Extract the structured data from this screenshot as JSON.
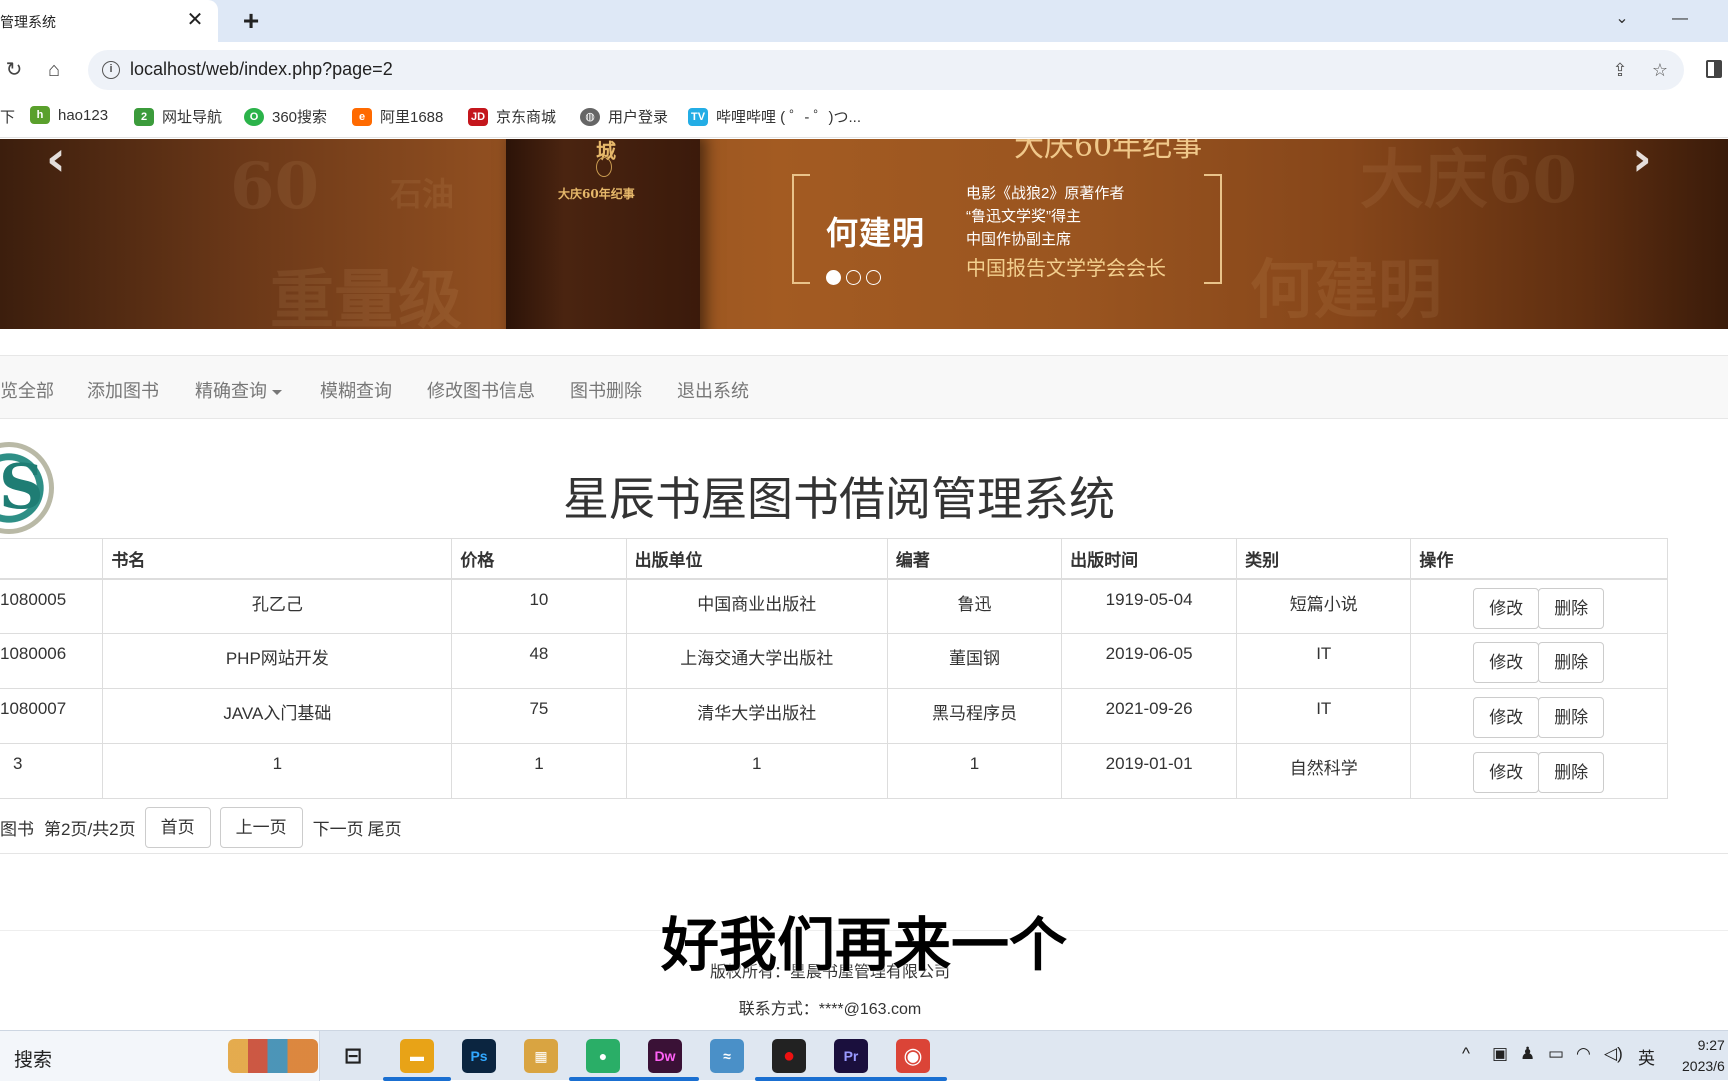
{
  "browser": {
    "tab_title": "管理系统",
    "tab_close": "✕",
    "new_tab": "+",
    "url": "localhost/web/index.php?page=2",
    "win_chevron": "⌄",
    "win_minimize": "—",
    "bookmarks": [
      {
        "label": "下",
        "icon": "download-icon",
        "color": "#666"
      },
      {
        "label": "hao123",
        "icon": "hao123-icon",
        "color": "#5aa02c"
      },
      {
        "label": "网址导航",
        "icon": "navigation-icon",
        "color": "#3b9b3b"
      },
      {
        "label": "360搜索",
        "icon": "360-search-icon",
        "color": "#2bb34a"
      },
      {
        "label": "阿里1688",
        "icon": "alibaba-icon",
        "color": "#ff6a00"
      },
      {
        "label": "京东商城",
        "icon": "jd-icon",
        "color": "#c4161c"
      },
      {
        "label": "用户登录",
        "icon": "globe-icon",
        "color": "#666"
      },
      {
        "label": "哔哩哔哩 ( ゜- ゜)つ...",
        "icon": "bilibili-icon",
        "color": "#23ade5"
      }
    ]
  },
  "banner": {
    "book_char": "城",
    "book_subtitle": "大庆60年纪事",
    "top_text": "大庆60年纪事",
    "author": "何建明",
    "credentials": [
      "电影《战狼2》原著作者",
      "“鲁迅文学奖”得主",
      "中国作协副主席"
    ],
    "credential_big": "中国报告文学学会会长",
    "ghost_texts": [
      "60",
      "石油",
      "重量级",
      "大庆60",
      "何建明"
    ],
    "prev_arrow": "‹",
    "next_arrow": "›",
    "slides": [
      true,
      false,
      false
    ]
  },
  "nav": {
    "items": [
      "览全部",
      "添加图书",
      "精确查询",
      "模糊查询",
      "修改图书信息",
      "图书删除",
      "退出系统"
    ]
  },
  "page": {
    "title": "星辰书屋图书借阅管理系统",
    "logo_letter": "S"
  },
  "table": {
    "headers": [
      "",
      "书名",
      "价格",
      "出版单位",
      "编著",
      "出版时间",
      "类别",
      "操作"
    ],
    "rows": [
      {
        "id": "1080005",
        "name": "孔乙己",
        "price": "10",
        "publisher": "中国商业出版社",
        "author": "鲁迅",
        "date": "1919-05-04",
        "category": "短篇小说"
      },
      {
        "id": "1080006",
        "name": "PHP网站开发",
        "price": "48",
        "publisher": "上海交通大学出版社",
        "author": "董国钢",
        "date": "2019-06-05",
        "category": "IT"
      },
      {
        "id": "1080007",
        "name": "JAVA入门基础",
        "price": "75",
        "publisher": "清华大学出版社",
        "author": "黑马程序员",
        "date": "2021-09-26",
        "category": "IT"
      },
      {
        "id": "3",
        "name": "1",
        "price": "1",
        "publisher": "1",
        "author": "1",
        "date": "2019-01-01",
        "category": "自然科学"
      }
    ],
    "edit_label": "修改",
    "delete_label": "删除"
  },
  "pager": {
    "prefix": "图书",
    "status": "第2页/共2页",
    "first": "首页",
    "prev": "上一页",
    "next": "下一页",
    "last": "尾页"
  },
  "overlay_caption": "好我们再来一个",
  "footer": {
    "copyright": "版权所有：星晨书屋管理有限公司",
    "contact": "联系方式：****@163.com"
  },
  "taskbar": {
    "search_label": "搜索",
    "apps": [
      {
        "name": "task-view-icon",
        "label": "⊟",
        "color": "transparent"
      },
      {
        "name": "file-explorer-icon",
        "label": "▬",
        "color": "#e8a317"
      },
      {
        "name": "photoshop-icon",
        "label": "Ps",
        "color": "#0b2540"
      },
      {
        "name": "archive-icon",
        "label": "▦",
        "color": "#d9a441"
      },
      {
        "name": "wechat-icon",
        "label": "●",
        "color": "#2aae67"
      },
      {
        "name": "dreamweaver-icon",
        "label": "Dw",
        "color": "#3a1136"
      },
      {
        "name": "dolphin-icon",
        "label": "≈",
        "color": "#4a90c8"
      },
      {
        "name": "recorder-icon",
        "label": "●",
        "color": "#222"
      },
      {
        "name": "premiere-icon",
        "label": "Pr",
        "color": "#1a0f3d"
      },
      {
        "name": "chrome-icon",
        "label": "◉",
        "color": "#db4437"
      }
    ],
    "tray": [
      "^",
      "▣",
      "♟",
      "▭",
      "◠",
      "◁)",
      "英"
    ],
    "time": "9:27",
    "date": "2023/6"
  }
}
